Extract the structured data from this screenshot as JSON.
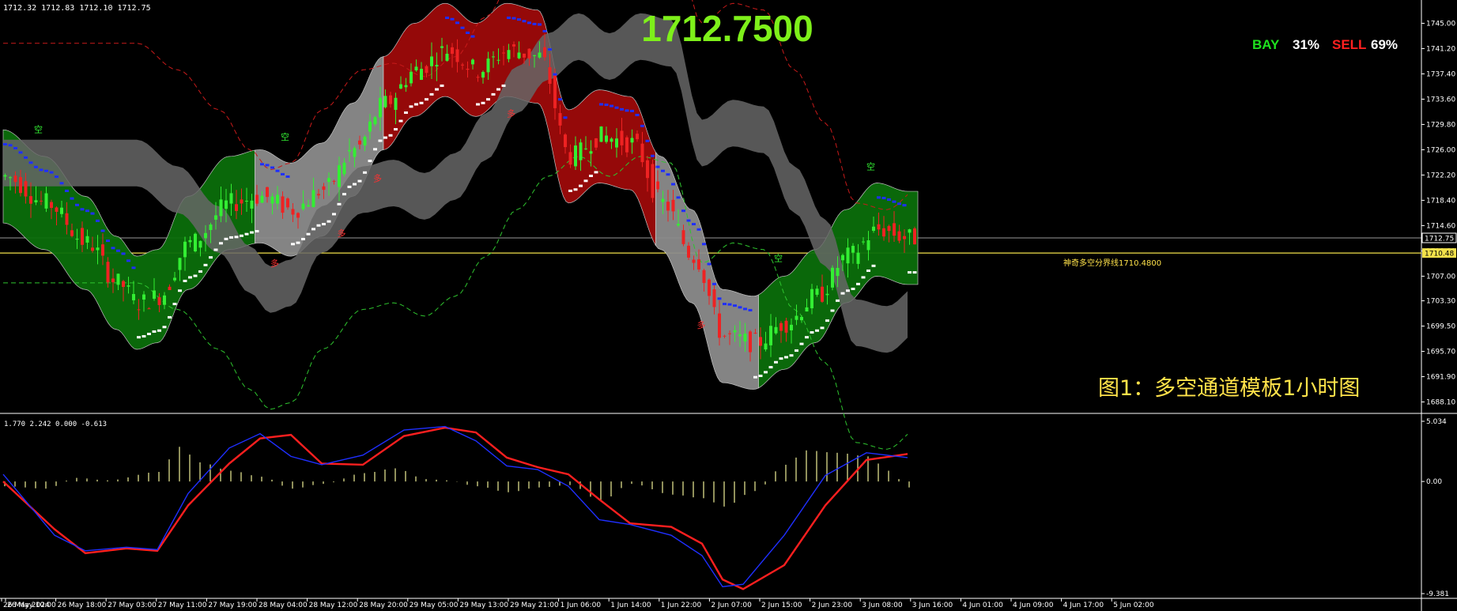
{
  "header": {
    "ohlc_text": "1712.32 1712.83 1712.10 1712.75",
    "big_price": "1712.7500",
    "bay_label": "BAY",
    "bay_pct": "31%",
    "sell_label": "SELL",
    "sell_pct": "69%",
    "caption": "图1：多空通道模板1小时图",
    "divider_label": "神奇多空分界线1710.4800",
    "current_price_tag": "1712.75",
    "divider_price_tag": "1710.48"
  },
  "colors": {
    "background": "#000000",
    "bull_candle": "#33ee33",
    "bear_candle": "#ee2222",
    "exhaust_candle": "#ffffff",
    "magenta_candle": "#ee22ee",
    "band_green": "#0b6e0b",
    "band_red": "#9e0a0a",
    "band_gray": "#8c8c8c",
    "outer_gray": "#666666",
    "macd_signal": "#ff1f1f",
    "macd_line": "#1f2fff",
    "histogram": "#dede8c",
    "price_text": "#7ef01a",
    "caption_text": "#ffe24a"
  },
  "labels": {
    "long_marker": "多",
    "short_marker": "空"
  },
  "chart_data": [
    {
      "type": "candlestick",
      "title": "",
      "ylim": [
        1686.5,
        1748.5
      ],
      "y_ticks": [
        "1745.00",
        "1741.20",
        "1737.40",
        "1733.60",
        "1729.80",
        "1726.00",
        "1722.20",
        "1718.40",
        "1714.60",
        "1710.80",
        "1707.00",
        "1703.30",
        "1699.50",
        "1695.70",
        "1691.90",
        "1688.10"
      ],
      "current_price": 1712.75,
      "divider_price": 1710.48,
      "channel": {
        "segment_colors": [
          "green",
          "gray",
          "red",
          "gray",
          "green"
        ],
        "segment_breaks": [
          "27 May 19:00",
          "29 May 05:00",
          "2 Jun 15:00",
          "3 Jun 08:00"
        ]
      },
      "price_path": [
        {
          "t": 0,
          "p": 1722
        },
        {
          "t": 8,
          "p": 1718
        },
        {
          "t": 16,
          "p": 1712
        },
        {
          "t": 22,
          "p": 1706
        },
        {
          "t": 26,
          "p": 1703
        },
        {
          "t": 30,
          "p": 1704
        },
        {
          "t": 36,
          "p": 1712
        },
        {
          "t": 44,
          "p": 1718
        },
        {
          "t": 50,
          "p": 1719
        },
        {
          "t": 56,
          "p": 1717
        },
        {
          "t": 62,
          "p": 1720
        },
        {
          "t": 68,
          "p": 1726
        },
        {
          "t": 74,
          "p": 1733
        },
        {
          "t": 80,
          "p": 1738
        },
        {
          "t": 86,
          "p": 1741
        },
        {
          "t": 92,
          "p": 1738
        },
        {
          "t": 98,
          "p": 1741
        },
        {
          "t": 104,
          "p": 1740
        },
        {
          "t": 110,
          "p": 1725
        },
        {
          "t": 116,
          "p": 1728
        },
        {
          "t": 122,
          "p": 1727
        },
        {
          "t": 128,
          "p": 1718
        },
        {
          "t": 134,
          "p": 1710
        },
        {
          "t": 140,
          "p": 1698
        },
        {
          "t": 146,
          "p": 1697
        },
        {
          "t": 152,
          "p": 1700
        },
        {
          "t": 158,
          "p": 1704
        },
        {
          "t": 164,
          "p": 1710
        },
        {
          "t": 170,
          "p": 1714
        },
        {
          "t": 176,
          "p": 1712.75
        }
      ]
    },
    {
      "type": "line",
      "title": "",
      "header_text": "1.770 2.242 0.000 -0.613",
      "ylim": [
        -9.381,
        5.034
      ],
      "y_ticks": [
        "5.034",
        "0.00",
        "-9.381"
      ],
      "x_labels": [
        "26 May 2024",
        "26 May 10:00",
        "26 May 18:00",
        "27 May 03:00",
        "27 May 11:00",
        "27 May 19:00",
        "28 May 04:00",
        "28 May 12:00",
        "28 May 20:00",
        "29 May 05:00",
        "29 May 13:00",
        "29 May 21:00",
        "1 Jun 06:00",
        "1 Jun 14:00",
        "1 Jun 22:00",
        "2 Jun 07:00",
        "2 Jun 15:00",
        "2 Jun 23:00",
        "3 Jun 08:00",
        "3 Jun 16:00",
        "4 Jun 01:00",
        "4 Jun 09:00",
        "4 Jun 17:00",
        "5 Jun 02:00"
      ],
      "series": [
        {
          "color": "red",
          "values": [
            [
              0,
              0
            ],
            [
              10,
              -4
            ],
            [
              16,
              -6
            ],
            [
              24,
              -5.6
            ],
            [
              30,
              -5.8
            ],
            [
              36,
              -2
            ],
            [
              44,
              1.5
            ],
            [
              50,
              3.6
            ],
            [
              56,
              3.9
            ],
            [
              62,
              1.5
            ],
            [
              70,
              1.4
            ],
            [
              78,
              3.8
            ],
            [
              86,
              4.5
            ],
            [
              92,
              4.1
            ],
            [
              98,
              2
            ],
            [
              104,
              1.2
            ],
            [
              110,
              0.6
            ],
            [
              116,
              -1.5
            ],
            [
              122,
              -3.5
            ],
            [
              130,
              -3.8
            ],
            [
              136,
              -5.2
            ],
            [
              140,
              -8.2
            ],
            [
              144,
              -9
            ],
            [
              152,
              -7
            ],
            [
              160,
              -2
            ],
            [
              168,
              1.8
            ],
            [
              176,
              2.3
            ]
          ]
        },
        {
          "color": "blue",
          "values": [
            [
              0,
              0.6
            ],
            [
              10,
              -4.5
            ],
            [
              16,
              -5.8
            ],
            [
              24,
              -5.5
            ],
            [
              30,
              -5.7
            ],
            [
              36,
              -1
            ],
            [
              44,
              2.8
            ],
            [
              50,
              4
            ],
            [
              56,
              2.1
            ],
            [
              62,
              1.4
            ],
            [
              70,
              2.2
            ],
            [
              78,
              4.3
            ],
            [
              86,
              4.6
            ],
            [
              92,
              3.4
            ],
            [
              98,
              1.3
            ],
            [
              104,
              1
            ],
            [
              110,
              -0.4
            ],
            [
              116,
              -3.2
            ],
            [
              122,
              -3.6
            ],
            [
              130,
              -4.5
            ],
            [
              136,
              -6.2
            ],
            [
              140,
              -8.8
            ],
            [
              144,
              -8.6
            ],
            [
              152,
              -4.5
            ],
            [
              160,
              0.5
            ],
            [
              168,
              2.4
            ],
            [
              176,
              2
            ]
          ]
        },
        {
          "color": "khaki",
          "type": "histogram",
          "values": [
            [
              0,
              -0.4
            ],
            [
              8,
              -0.6
            ],
            [
              14,
              0.3
            ],
            [
              20,
              0.1
            ],
            [
              30,
              0.8
            ],
            [
              34,
              2.9
            ],
            [
              38,
              1.6
            ],
            [
              44,
              0.9
            ],
            [
              50,
              0.4
            ],
            [
              56,
              -0.6
            ],
            [
              62,
              -0.2
            ],
            [
              70,
              0.7
            ],
            [
              76,
              1.1
            ],
            [
              82,
              0.2
            ],
            [
              86,
              0.1
            ],
            [
              92,
              -0.4
            ],
            [
              98,
              -0.9
            ],
            [
              104,
              -0.5
            ],
            [
              110,
              -0.3
            ],
            [
              116,
              -1.6
            ],
            [
              122,
              -0.2
            ],
            [
              130,
              -1.1
            ],
            [
              136,
              -1.4
            ],
            [
              140,
              -2.1
            ],
            [
              146,
              -0.8
            ],
            [
              152,
              1.4
            ],
            [
              156,
              2.6
            ],
            [
              162,
              2.4
            ],
            [
              168,
              2.1
            ],
            [
              172,
              0.9
            ],
            [
              176,
              -0.5
            ]
          ]
        }
      ]
    }
  ]
}
